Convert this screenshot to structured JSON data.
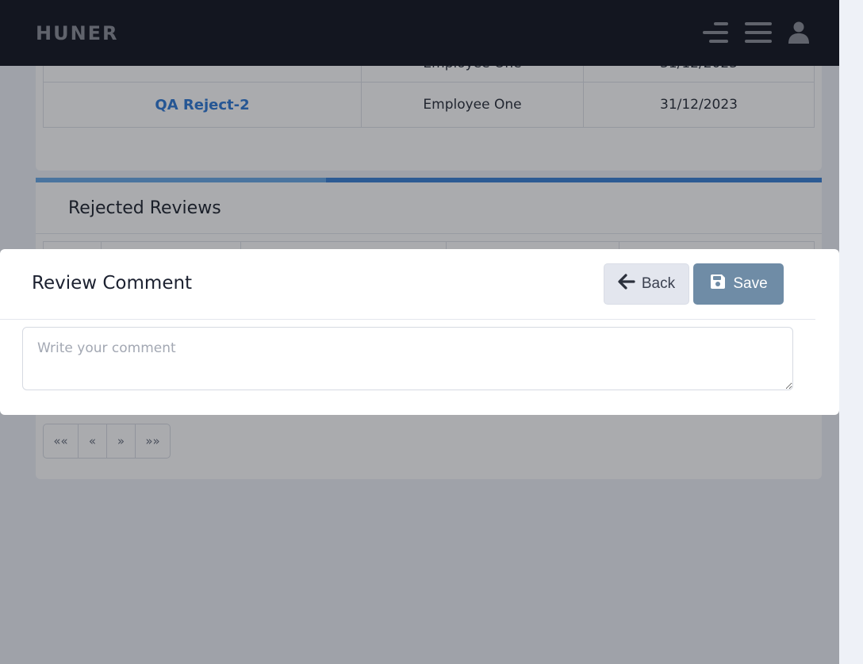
{
  "app": {
    "brand": "HUNER"
  },
  "icons": {
    "menu_align": "menu-align-right-icon",
    "menu": "hamburger-menu-icon",
    "user": "user-icon"
  },
  "colors": {
    "topbar": "#141722",
    "accent": "#3b82d6",
    "save_button": "#6f8ca6",
    "link": "#2f7bd6"
  },
  "reviews_table": {
    "rows": [
      {
        "name": "",
        "employee": "Employee One",
        "date": "31/12/2023"
      },
      {
        "name": "QA Reject-2",
        "employee": "Employee One",
        "date": "31/12/2023"
      }
    ]
  },
  "rejected": {
    "title": "Rejected Reviews"
  },
  "pagination": {
    "first": "««",
    "prev": "«",
    "next": "»",
    "last": "»»"
  },
  "modal": {
    "title": "Review Comment",
    "back_label": "Back",
    "save_label": "Save",
    "comment_placeholder": "Write your comment",
    "comment_value": ""
  }
}
